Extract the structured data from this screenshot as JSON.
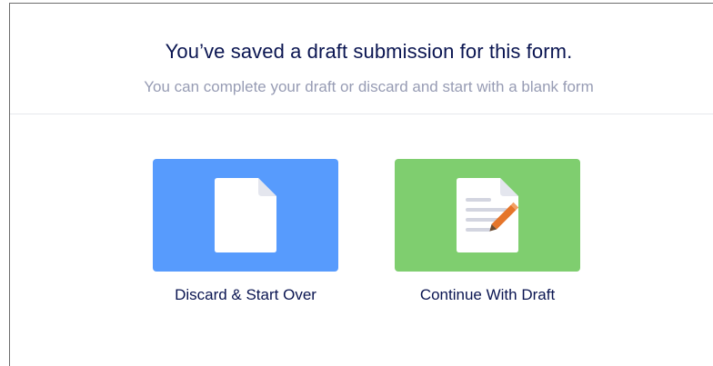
{
  "dialog": {
    "title": "You’ve saved a draft submission for this form.",
    "subtitle": "You can complete your draft or discard and start with a blank form"
  },
  "options": [
    {
      "label": "Discard & Start Over",
      "icon": "blank-document-icon",
      "color": "#579bfd"
    },
    {
      "label": "Continue With Draft",
      "icon": "document-edit-icon",
      "color": "#7fce6f"
    }
  ],
  "colors": {
    "title": "#0a1551",
    "subtitle": "#979cb4",
    "divider": "#e6e7ec",
    "pencil": "#e5752a"
  }
}
